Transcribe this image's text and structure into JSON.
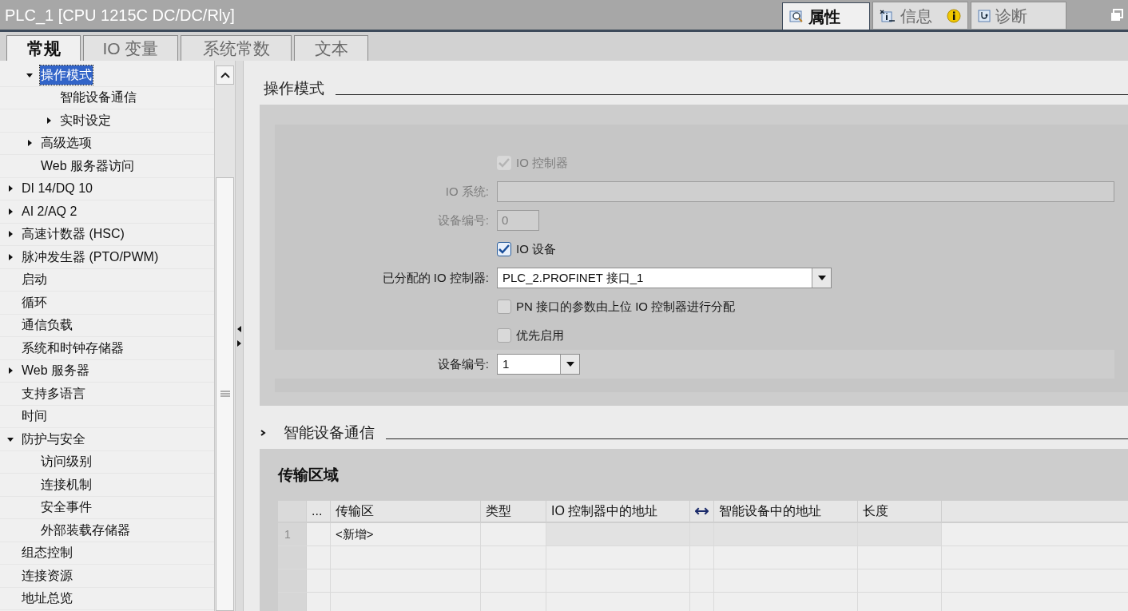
{
  "window": {
    "title": "PLC_1 [CPU 1215C DC/DC/Rly]"
  },
  "inspector_tabs": [
    {
      "label": "属性",
      "selected": true,
      "kind": "properties"
    },
    {
      "label": "信息",
      "selected": false,
      "kind": "info"
    },
    {
      "label": "诊断",
      "selected": false,
      "kind": "diagnostics"
    }
  ],
  "tabs": [
    {
      "label": "常规",
      "selected": true
    },
    {
      "label": "IO 变量",
      "selected": false
    },
    {
      "label": "系统常数",
      "selected": false
    },
    {
      "label": "文本",
      "selected": false
    }
  ],
  "tree": {
    "scrolled_children": [
      {
        "label": "操作模式",
        "selected": true,
        "expanded": true,
        "children": [
          {
            "label": "智能设备通信",
            "selected": false
          },
          {
            "label": "实时设定",
            "selected": false,
            "expanded": false
          }
        ]
      },
      {
        "label": "高级选项",
        "selected": false,
        "expanded": false
      },
      {
        "label": "Web 服务器访问",
        "selected": false
      }
    ],
    "items": [
      {
        "label": "DI 14/DQ 10",
        "selected": false,
        "expanded": false
      },
      {
        "label": "AI 2/AQ 2",
        "selected": false,
        "expanded": false
      },
      {
        "label": "高速计数器 (HSC)",
        "selected": false,
        "expanded": false
      },
      {
        "label": "脉冲发生器 (PTO/PWM)",
        "selected": false,
        "expanded": false
      },
      {
        "label": "启动",
        "selected": false
      },
      {
        "label": "循环",
        "selected": false
      },
      {
        "label": "通信负载",
        "selected": false
      },
      {
        "label": "系统和时钟存储器",
        "selected": false
      },
      {
        "label": "Web 服务器",
        "selected": false,
        "expanded": false
      },
      {
        "label": "支持多语言",
        "selected": false
      },
      {
        "label": "时间",
        "selected": false
      },
      {
        "label": "防护与安全",
        "selected": false,
        "expanded": true,
        "children": [
          {
            "label": "访问级别",
            "selected": false
          },
          {
            "label": "连接机制",
            "selected": false
          },
          {
            "label": "安全事件",
            "selected": false
          },
          {
            "label": "外部装载存储器",
            "selected": false
          }
        ]
      },
      {
        "label": "组态控制",
        "selected": false
      },
      {
        "label": "连接资源",
        "selected": false
      },
      {
        "label": "地址总览",
        "selected": false
      }
    ]
  },
  "section": {
    "title": "操作模式",
    "form": [
      {
        "kind": "checkbox",
        "label": "IO 控制器",
        "checked": true,
        "disabled": true
      },
      {
        "kind": "text-field",
        "label": "IO 系统:",
        "disabled": true
      },
      {
        "kind": "number-field",
        "label": "设备编号:",
        "value": "0",
        "disabled": true
      },
      {
        "kind": "checkbox",
        "label": "IO 设备",
        "checked": true,
        "disabled": false
      },
      {
        "kind": "dropdown",
        "label": "已分配的 IO 控制器:",
        "value": "PLC_2.PROFINET 接口_1",
        "disabled": false
      },
      {
        "kind": "checkbox",
        "label": "PN 接口的参数由上位 IO 控制器进行分配",
        "checked": false,
        "disabled": false
      },
      {
        "kind": "checkbox",
        "label": "优先启用",
        "checked": false,
        "disabled": false
      },
      {
        "kind": "number-dropdown",
        "label": "设备编号:",
        "value": "1",
        "disabled": false
      }
    ]
  },
  "subsection": {
    "title": "智能设备通信",
    "expanded": false,
    "panel_title": "传输区域",
    "columns": [
      {
        "kind": "text",
        "label": "..."
      },
      {
        "kind": "text",
        "label": "传输区"
      },
      {
        "kind": "text",
        "label": "类型"
      },
      {
        "kind": "text",
        "label": "IO 控制器中的地址"
      },
      {
        "kind": "arrow"
      },
      {
        "kind": "text",
        "label": "智能设备中的地址"
      },
      {
        "kind": "text",
        "label": "长度"
      }
    ],
    "rows": [
      {
        "number": "1",
        "transfer_area": "<新增>"
      }
    ]
  }
}
